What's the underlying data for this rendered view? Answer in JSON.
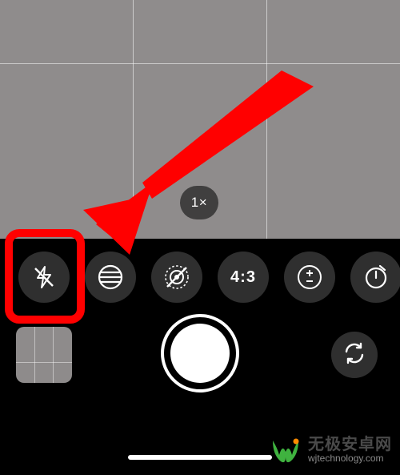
{
  "viewfinder": {
    "zoom_label": "1×"
  },
  "options": {
    "flash": {
      "state": "off",
      "icon": "flash-off"
    },
    "filter": {
      "icon": "filter-lines"
    },
    "live": {
      "icon": "live-off"
    },
    "aspect": {
      "label": "4:3"
    },
    "exposure": {
      "icon": "plus-minus"
    },
    "timer": {
      "icon": "timer"
    },
    "more": {
      "icon": "ellipsis"
    }
  },
  "controls": {
    "gallery": "last-photo-thumbnail",
    "shutter": "shutter",
    "switch": "switch-camera"
  },
  "annotation": {
    "type": "red-arrow-and-box",
    "target": "flash-button"
  },
  "watermark": {
    "title": "无极安卓网",
    "subtitle": "wjtechnology.com"
  }
}
